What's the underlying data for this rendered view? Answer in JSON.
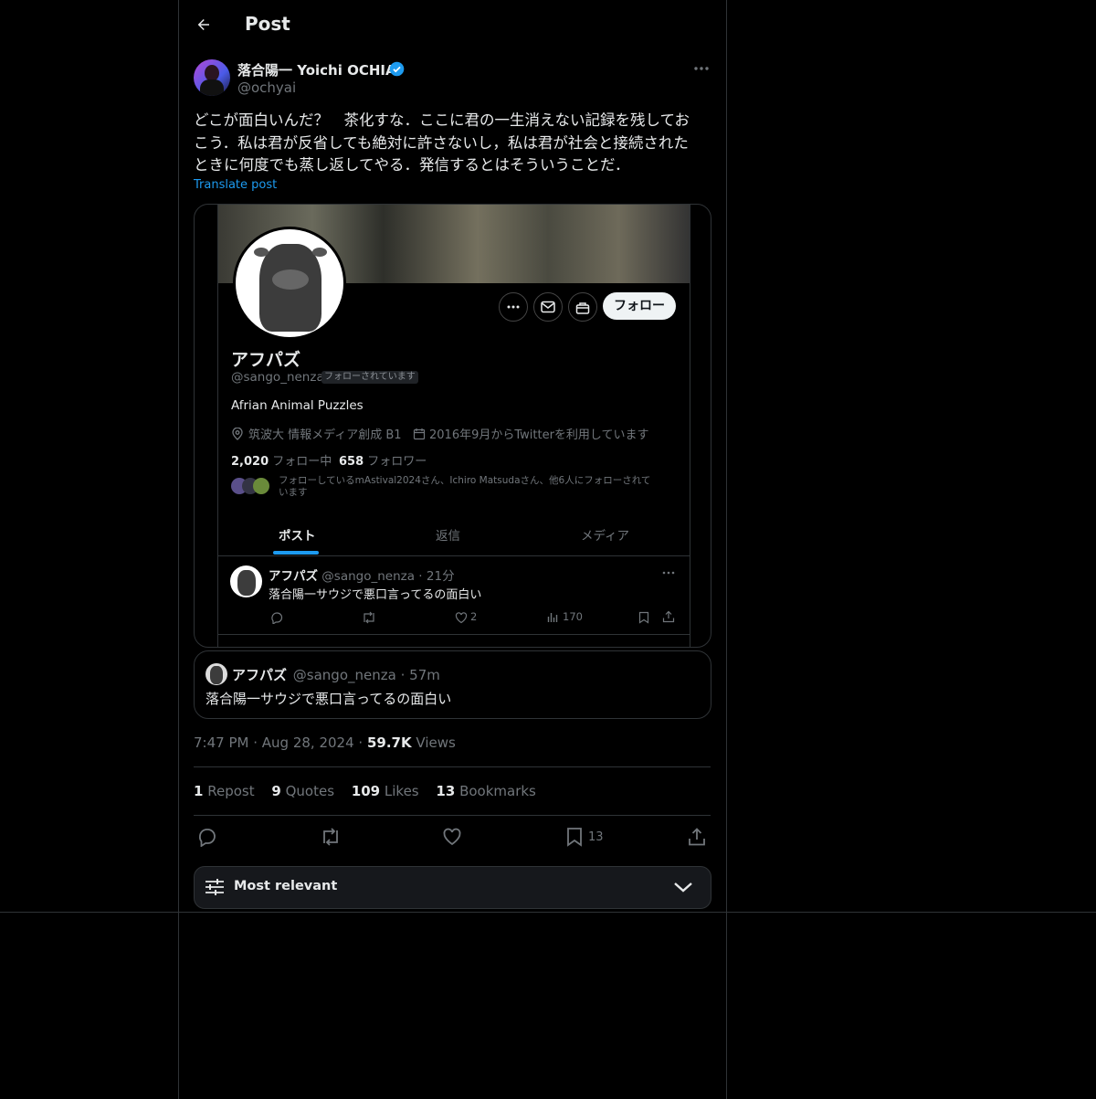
{
  "header": {
    "title": "Post"
  },
  "author": {
    "name": "落合陽一 Yoichi OCHIAI",
    "handle": "@ochyai",
    "verified": true
  },
  "post": {
    "text_lines": [
      "どこが面白いんだ？　茶化すな．ここに君の一生消えない記録を残してお",
      "こう．私は君が反省しても絶対に許さないし，私は君が社会と接続された",
      "ときに何度でも蒸し返してやる．発信するとはそういうことだ．"
    ],
    "translate_label": "Translate post",
    "timestamp": "7:47 PM",
    "date": "Aug 28, 2024",
    "views_count": "59.7K",
    "views_label": "Views"
  },
  "screenshot": {
    "follow_button": "フォロー",
    "name": "アフパズ",
    "handle": "@sango_nenza",
    "follows_you": "フォローされています",
    "bio": "Afrian Animal Puzzles",
    "location": "筑波大 情報メディア創成 B1",
    "joined": "2016年9月からTwitterを利用しています",
    "following_count": "2,020",
    "following_label": "フォロー中",
    "followers_count": "658",
    "followers_label": "フォロワー",
    "followed_by": "フォローしているmAstival2024さん、Ichiro Matsudaさん、他6人にフォローされて",
    "followed_by_2": "います",
    "tabs": [
      "ポスト",
      "返信",
      "メディア"
    ],
    "inner_post": {
      "name": "アフパズ",
      "handle_time": "@sango_nenza · 21分",
      "text": "落合陽一サウジで悪口言ってるの面白い",
      "likes": "2",
      "views": "170"
    }
  },
  "quote": {
    "name": "アフパズ",
    "handle": "@sango_nenza",
    "time": "57m",
    "text": "落合陽一サウジで悪口言ってるの面白い"
  },
  "stats": {
    "reposts_count": "1",
    "reposts_label": "Repost",
    "quotes_count": "9",
    "quotes_label": "Quotes",
    "likes_count": "109",
    "likes_label": "Likes",
    "bookmarks_count": "13",
    "bookmarks_label": "Bookmarks"
  },
  "actions": {
    "bookmark_count": "13"
  },
  "sort": {
    "label": "Most relevant"
  },
  "colors": {
    "accent": "#1d9bf0",
    "translate": "#1d9bf0",
    "background": "#000000",
    "border": "#2f3336"
  }
}
